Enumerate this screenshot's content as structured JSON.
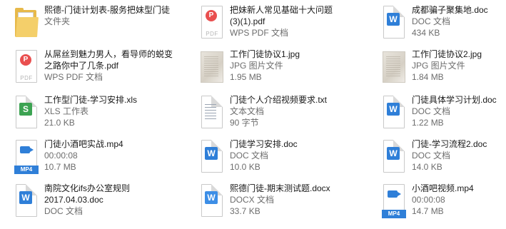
{
  "items": [
    {
      "name": "熙德-门徒计划表-服务把妹型门徒",
      "type": "文件夹",
      "size": "",
      "icon": "folder-icon"
    },
    {
      "name": "把妹新人常见基础十大问题",
      "name2": "(3)(1).pdf",
      "type": "WPS PDF 文档",
      "size": "",
      "icon": "pdf-icon"
    },
    {
      "name": "成都骗子聚集地.doc",
      "type": "DOC 文档",
      "size": "434 KB",
      "icon": "word-doc-icon"
    },
    {
      "name": "从屌丝到魅力男人，看导师的蜕变",
      "name2": "之路你中了几条.pdf",
      "type": "WPS PDF 文档",
      "size": "",
      "icon": "pdf-icon"
    },
    {
      "name": "工作门徒协议1.jpg",
      "type": "JPG 图片文件",
      "size": "1.95 MB",
      "icon": "jpg-thumbnail-icon"
    },
    {
      "name": "工作门徒协议2.jpg",
      "type": "JPG 图片文件",
      "size": "1.84 MB",
      "icon": "jpg-thumbnail-icon"
    },
    {
      "name": "工作型门徒-学习安排.xls",
      "type": "XLS 工作表",
      "size": "21.0 KB",
      "icon": "xls-icon"
    },
    {
      "name": "门徒个人介绍视频要求.txt",
      "type": "文本文档",
      "size": "90 字节",
      "icon": "txt-icon"
    },
    {
      "name": "门徒具体学习计划.doc",
      "type": "DOC 文档",
      "size": "1.22 MB",
      "icon": "word-doc-icon"
    },
    {
      "name": "门徒小酒吧实战.mp4",
      "type": "00:00:08",
      "size": "10.7 MB",
      "icon": "mp4-icon"
    },
    {
      "name": "门徒学习安排.doc",
      "type": "DOC 文档",
      "size": "10.0 KB",
      "icon": "word-doc-icon"
    },
    {
      "name": "门徒-学习流程2.doc",
      "type": "DOC 文档",
      "size": "14.0 KB",
      "icon": "word-doc-icon"
    },
    {
      "name": "南院文化ifs办公室规则",
      "name2": "2017.04.03.doc",
      "type": "DOC 文档",
      "size": "",
      "icon": "word-doc-icon"
    },
    {
      "name": "熙德门徒-期末测试题.docx",
      "type": "DOCX 文档",
      "size": "33.7 KB",
      "icon": "word-docx-icon"
    },
    {
      "name": "小酒吧视频.mp4",
      "type": "00:00:08",
      "size": "14.7 MB",
      "icon": "mp4-icon"
    }
  ],
  "labels": {
    "pdf": "PDF",
    "mp4": "MP4",
    "pdf_mark": "P",
    "word_mark": "W",
    "xls_mark": "S"
  }
}
